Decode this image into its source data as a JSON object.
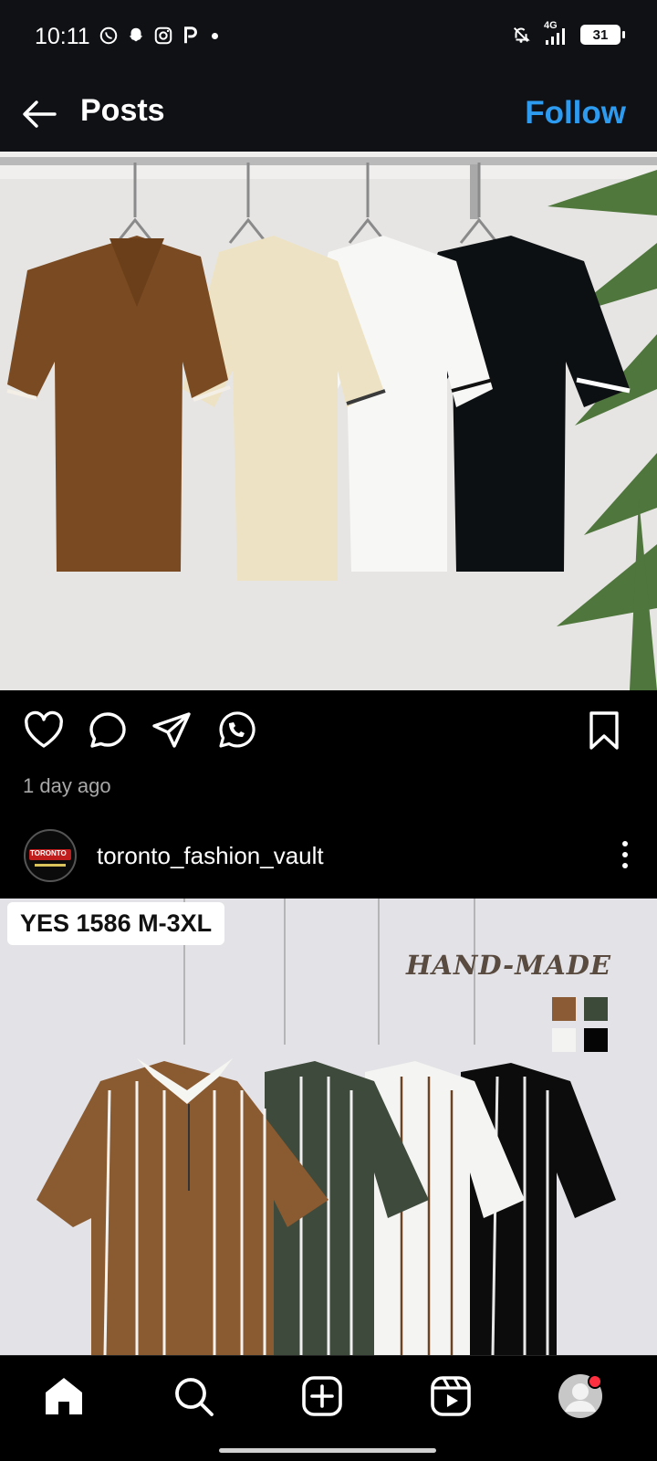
{
  "status_bar": {
    "time": "10:11",
    "network": "4G",
    "battery": "31"
  },
  "header": {
    "title": "Posts",
    "follow_label": "Follow"
  },
  "post1": {
    "timestamp": "1 day ago"
  },
  "post2": {
    "username": "toronto_fashion_vault",
    "avatar_text": "TORONTO",
    "overlay_tag": "YES 1586 M-3XL",
    "overlay_brand": "HAND-MADE"
  },
  "colors": {
    "accent": "#2d9bf0",
    "bar_bg": "#0f1115"
  },
  "icons": {
    "back": "arrow-left-icon",
    "like": "heart-icon",
    "comment": "comment-icon",
    "share": "send-icon",
    "whatsapp": "whatsapp-icon",
    "save": "bookmark-icon",
    "more": "more-vertical-icon",
    "nav": [
      "home-icon",
      "search-icon",
      "create-icon",
      "reels-icon",
      "profile-icon"
    ]
  }
}
